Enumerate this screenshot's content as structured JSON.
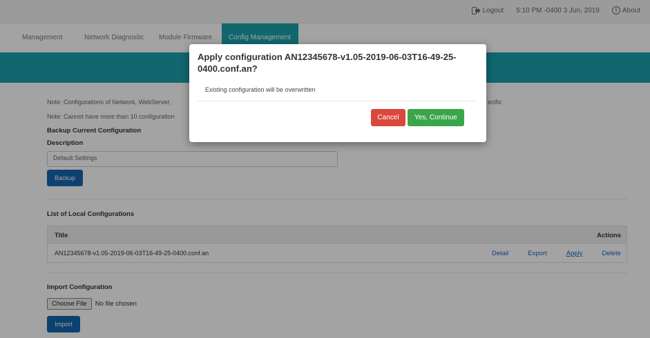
{
  "topbar": {
    "logout_label": "Logout",
    "datetime": "5:10 PM -0400 3 Jun, 2019",
    "about_label": "About"
  },
  "nav": {
    "tabs": [
      {
        "label": "Management"
      },
      {
        "label": "Network Diagnostic"
      },
      {
        "label": "Module Firmware"
      },
      {
        "label": "Config Management",
        "active": true
      }
    ]
  },
  "content": {
    "note1": "Note: Configurations of Network, WebServer, ",
    "note1_tail": "ecific",
    "note2": "Note: Cannot have more than 10 configuration",
    "backup_heading": "Backup Current Configuration",
    "description_label": "Description",
    "description_value": "Default Settings",
    "backup_button": "Backup",
    "list_heading": "List of Local Configurations",
    "table": {
      "col_title": "Title",
      "col_actions": "Actions",
      "rows": [
        {
          "title": "AN12345678-v1.05-2019-06-03T16-49-25-0400.conf.an",
          "detail": "Detail",
          "export": "Export",
          "apply": "Apply",
          "delete": "Delete"
        }
      ]
    },
    "import_heading": "Import Configuration",
    "choose_file_label": "Choose File",
    "no_file_label": "No file chosen",
    "import_button": "Import"
  },
  "modal": {
    "title": "Apply configuration AN12345678-v1.05-2019-06-03T16-49-25-0400.conf.an?",
    "body": "Existing configuration will be overwritten",
    "cancel_label": "Cancel",
    "continue_label": "Yes, Continue"
  },
  "colors": {
    "accent_teal": "#1ba1ad",
    "primary_blue": "#1467b0",
    "cancel_red": "#d9473d",
    "continue_green": "#3aa54b"
  },
  "icons": {
    "logout": "logout-icon",
    "about": "info-icon"
  }
}
